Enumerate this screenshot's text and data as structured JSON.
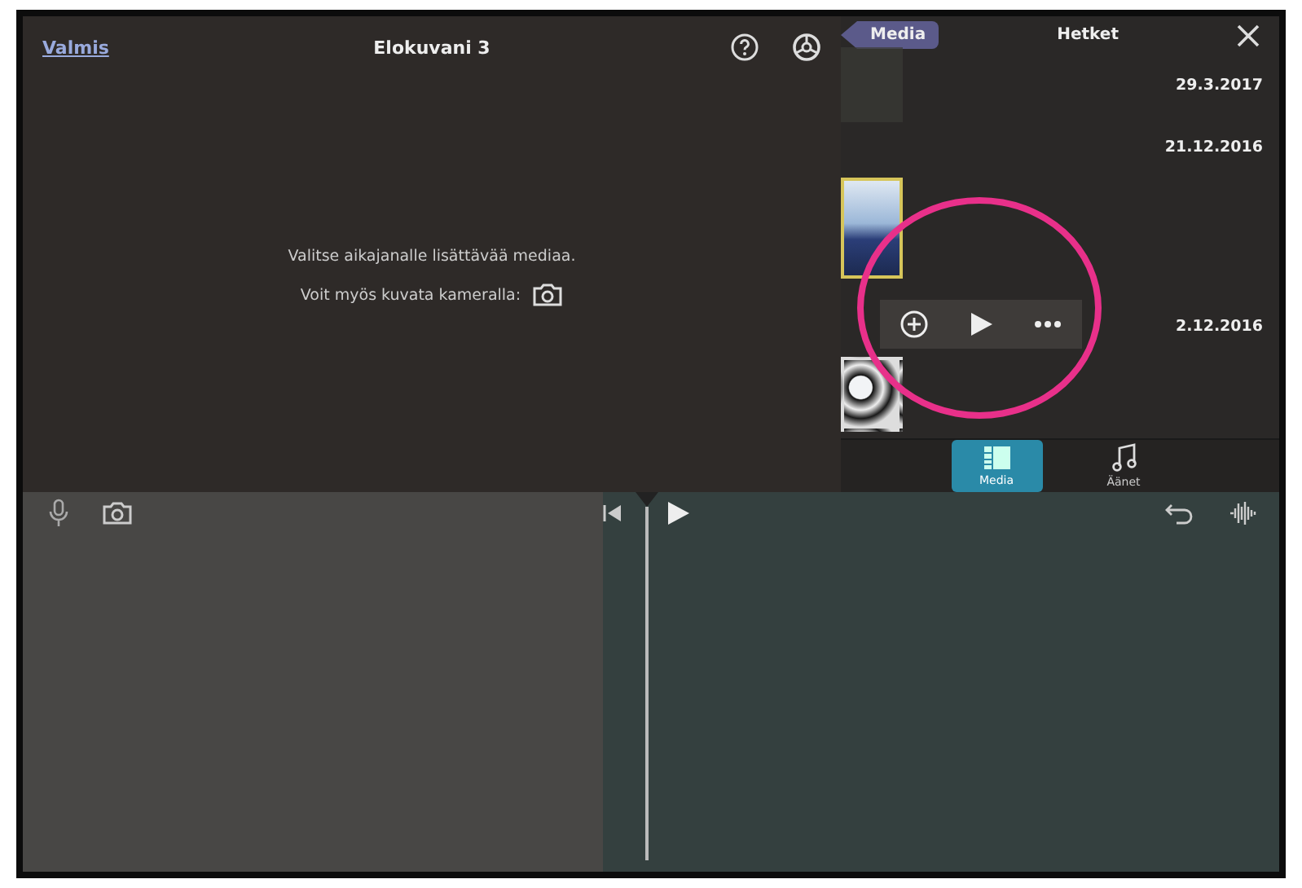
{
  "toolbar": {
    "done_link": "Valmis",
    "title": "Elokuvani 3"
  },
  "empty_state": {
    "line_1": "Valitse aikajanalle lisättävää mediaa.",
    "line_2": "Voit myös kuvata kameralla:"
  },
  "media_panel": {
    "back_button": "Media",
    "title": "Hetket",
    "rows": [
      {
        "date": "29.3.2017",
        "kind": "faint",
        "selected": false
      },
      {
        "date": "21.12.2016",
        "kind": "empty"
      },
      {
        "kind": "sky",
        "selected": true
      },
      {
        "date": "2.12.2016",
        "kind": "empty"
      },
      {
        "kind": "trees",
        "selected": false
      }
    ],
    "tabs": [
      {
        "label": "Media",
        "kind": "media",
        "selected": true
      },
      {
        "label": "Äänet",
        "kind": "audio",
        "selected": false
      }
    ]
  }
}
